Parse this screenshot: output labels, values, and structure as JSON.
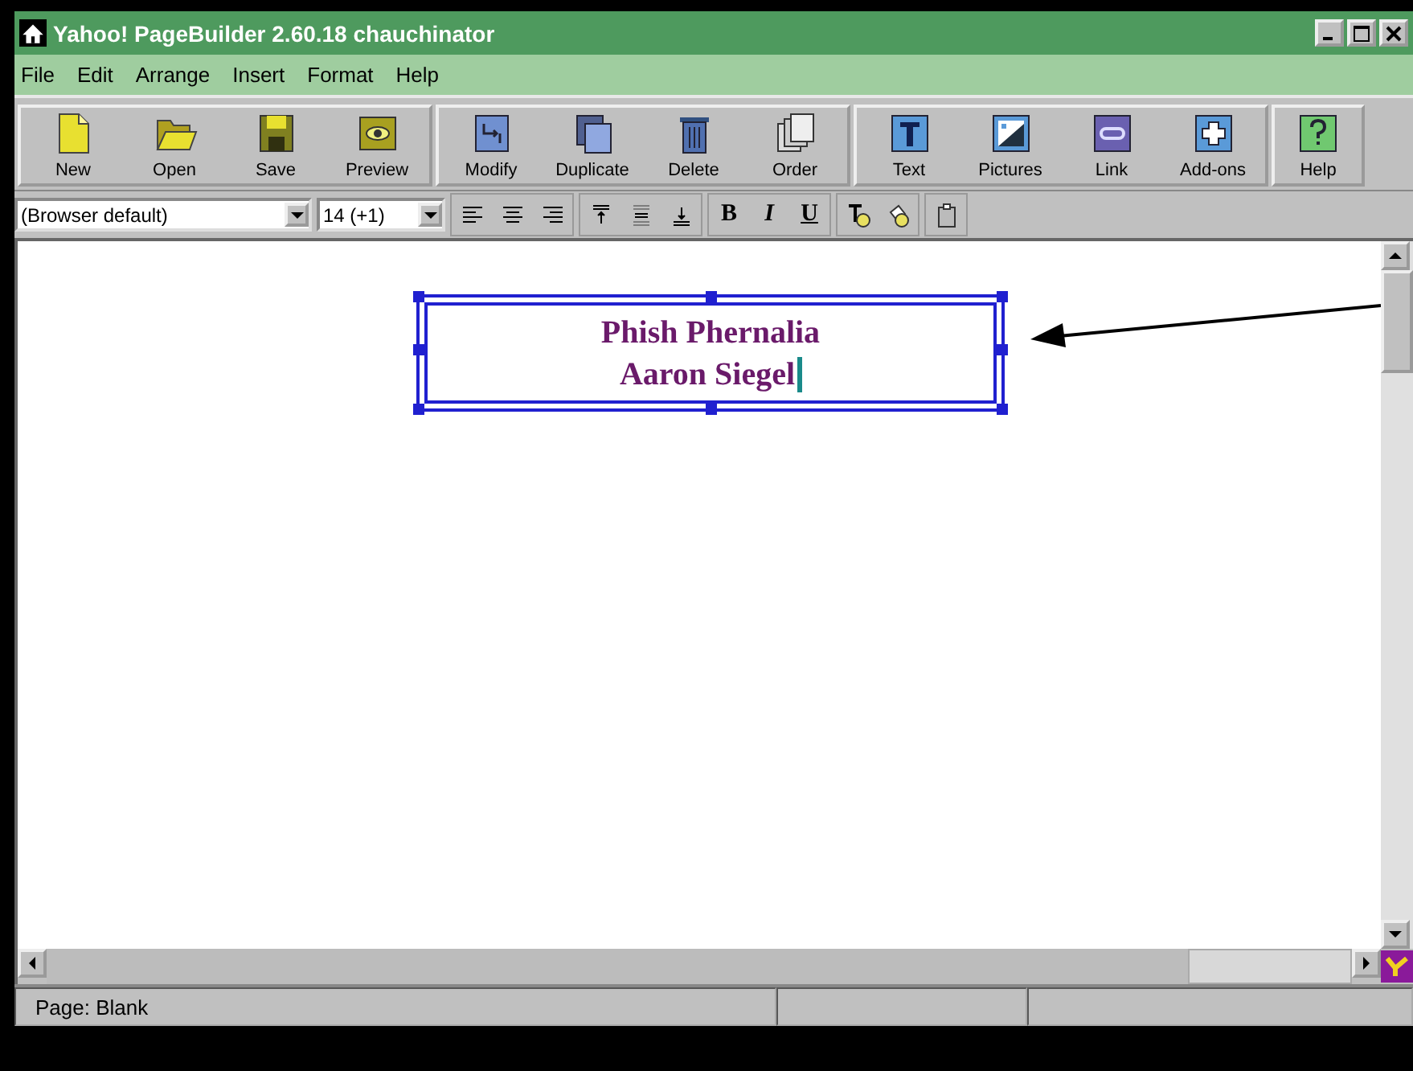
{
  "window": {
    "title": "Yahoo! PageBuilder 2.60.18 chauchinator"
  },
  "menu": [
    "File",
    "Edit",
    "Arrange",
    "Insert",
    "Format",
    "Help"
  ],
  "toolbar": [
    [
      {
        "label": "New",
        "kind": "new"
      },
      {
        "label": "Open",
        "kind": "open"
      },
      {
        "label": "Save",
        "kind": "save"
      },
      {
        "label": "Preview",
        "kind": "preview"
      }
    ],
    [
      {
        "label": "Modify",
        "kind": "modify"
      },
      {
        "label": "Duplicate",
        "kind": "duplicate"
      },
      {
        "label": "Delete",
        "kind": "delete"
      },
      {
        "label": "Order",
        "kind": "order"
      }
    ],
    [
      {
        "label": "Text",
        "kind": "text"
      },
      {
        "label": "Pictures",
        "kind": "pictures"
      },
      {
        "label": "Link",
        "kind": "link"
      },
      {
        "label": "Add-ons",
        "kind": "addons"
      }
    ],
    [
      {
        "label": "Help",
        "kind": "help"
      }
    ]
  ],
  "format_bar": {
    "font": "(Browser default)",
    "size": "14 (+1)",
    "groups": [
      [
        {
          "kind": "align-left"
        },
        {
          "kind": "align-center"
        },
        {
          "kind": "align-right"
        }
      ],
      [
        {
          "kind": "valign-top"
        },
        {
          "kind": "valign-middle"
        },
        {
          "kind": "valign-bottom"
        }
      ],
      [
        {
          "kind": "style",
          "text": "B"
        },
        {
          "kind": "style",
          "text": "I"
        },
        {
          "kind": "style",
          "text": "U"
        }
      ],
      [
        {
          "kind": "text-effect"
        },
        {
          "kind": "paint"
        }
      ],
      [
        {
          "kind": "clipboard"
        }
      ]
    ]
  },
  "text_box": {
    "lines": [
      "Phish Phernalia",
      "Aaron Siegel"
    ],
    "selected": true
  },
  "status_bar": [
    "Page: Blank"
  ]
}
